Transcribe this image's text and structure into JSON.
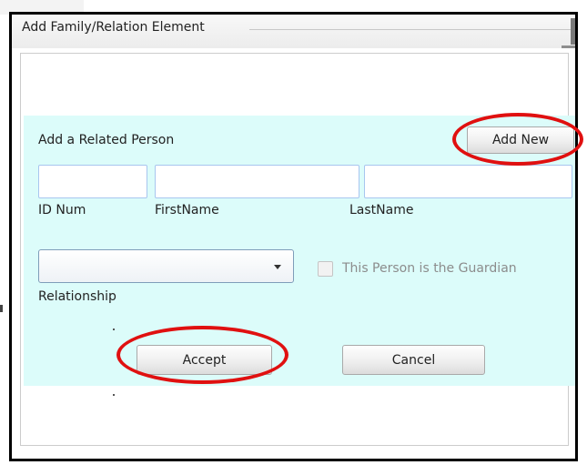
{
  "window": {
    "title": "Add Family/Relation Element"
  },
  "related_person": {
    "heading": "Add a Related Person",
    "add_new_label": "Add New",
    "id_num": {
      "label": "ID Num",
      "value": ""
    },
    "first_name": {
      "label": "FirstName",
      "value": ""
    },
    "last_name": {
      "label": "LastName",
      "value": ""
    },
    "relationship": {
      "label": "Relationship",
      "selected": ""
    },
    "guardian": {
      "label": "This Person is the Guardian",
      "checked": false,
      "enabled": false
    }
  },
  "actions": {
    "accept_label": "Accept",
    "cancel_label": "Cancel"
  },
  "colors": {
    "panel_background": "#dcfcfa",
    "highlight_oval": "#e01010",
    "window_border": "#000000"
  },
  "icons": {
    "dropdown": "chevron-down-icon"
  }
}
